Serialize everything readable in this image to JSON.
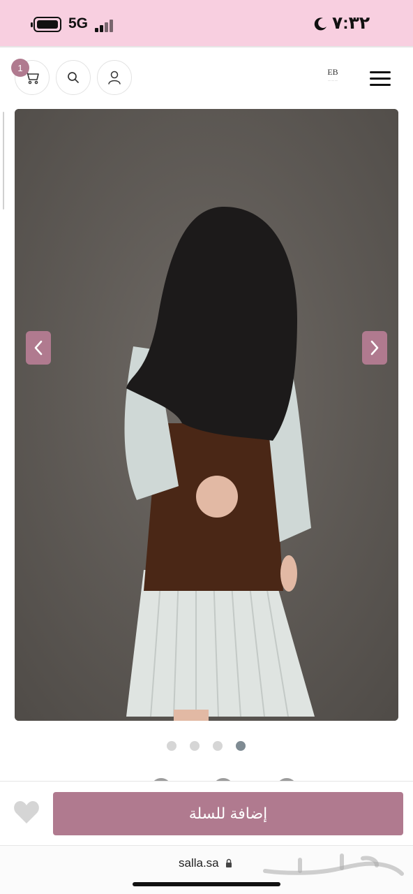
{
  "status_bar": {
    "time": "٧:٣٢",
    "network": "5G",
    "background_color": "#f8cfe0"
  },
  "header": {
    "cart_count": "1",
    "logo_text": "EB",
    "icons": [
      "cart-icon",
      "search-icon",
      "user-icon",
      "menu-icon"
    ]
  },
  "gallery": {
    "total_images": 4,
    "active_index": 3,
    "arrow_color": "#b07a8f"
  },
  "buy_bar": {
    "add_to_cart_label": "إضافة للسلة",
    "button_color": "#b07a8f"
  },
  "browser": {
    "url": "salla.sa"
  },
  "watermark": {
    "text": "حراج"
  }
}
